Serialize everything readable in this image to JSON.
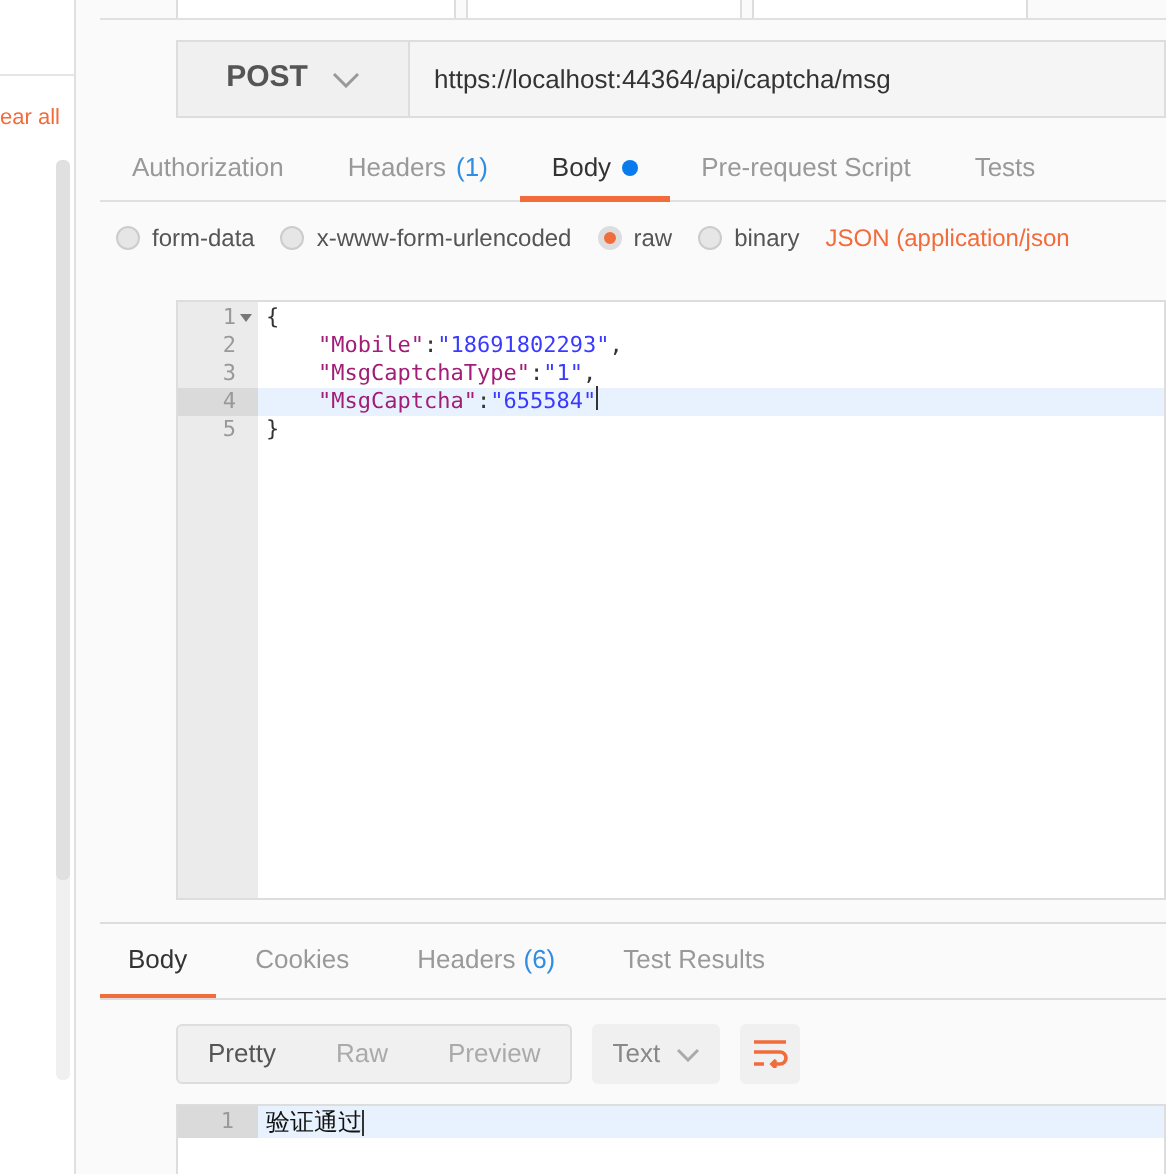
{
  "sidebar": {
    "clear_link": "ear all"
  },
  "request": {
    "method": "POST",
    "url": "https://localhost:44364/api/captcha/msg"
  },
  "request_tabs": [
    {
      "label": "Authorization",
      "dot": false,
      "selected": false
    },
    {
      "label": "Headers",
      "count": "(1)",
      "dot": false,
      "selected": false
    },
    {
      "label": "Body",
      "dot": true,
      "selected": true
    },
    {
      "label": "Pre-request Script",
      "dot": false,
      "selected": false
    },
    {
      "label": "Tests",
      "dot": false,
      "selected": false
    }
  ],
  "body_types": [
    {
      "label": "form-data",
      "selected": false
    },
    {
      "label": "x-www-form-urlencoded",
      "selected": false
    },
    {
      "label": "raw",
      "selected": true
    },
    {
      "label": "binary",
      "selected": false
    }
  ],
  "content_type": "JSON (application/json",
  "editor_lines": [
    {
      "number": "1",
      "fold": true,
      "current": false,
      "tokens": [
        {
          "kind": "punct",
          "text": "{"
        }
      ]
    },
    {
      "number": "2",
      "fold": false,
      "current": false,
      "tokens": [
        {
          "kind": "key",
          "text": "\"Mobile\""
        },
        {
          "kind": "punct",
          "text": ":"
        },
        {
          "kind": "string",
          "text": "\"18691802293\""
        },
        {
          "kind": "punct",
          "text": ","
        }
      ]
    },
    {
      "number": "3",
      "fold": false,
      "current": false,
      "tokens": [
        {
          "kind": "key",
          "text": "\"MsgCaptchaType\""
        },
        {
          "kind": "punct",
          "text": ":"
        },
        {
          "kind": "string",
          "text": "\"1\""
        },
        {
          "kind": "punct",
          "text": ","
        }
      ]
    },
    {
      "number": "4",
      "fold": false,
      "current": true,
      "tokens": [
        {
          "kind": "key",
          "text": "\"MsgCaptcha\""
        },
        {
          "kind": "punct",
          "text": ":"
        },
        {
          "kind": "string",
          "text": "\"655584\""
        }
      ]
    },
    {
      "number": "5",
      "fold": false,
      "current": false,
      "tokens": [
        {
          "kind": "punct",
          "text": "}"
        }
      ]
    }
  ],
  "response_tabs": [
    {
      "label": "Body",
      "selected": true
    },
    {
      "label": "Cookies",
      "selected": false
    },
    {
      "label": "Headers",
      "count": "(6)",
      "selected": false
    },
    {
      "label": "Test Results",
      "selected": false
    }
  ],
  "view_modes": [
    {
      "label": "Pretty",
      "selected": true
    },
    {
      "label": "Raw",
      "selected": false
    },
    {
      "label": "Preview",
      "selected": false
    }
  ],
  "format": "Text",
  "response_lines": [
    {
      "number": "1",
      "text": "验证通过",
      "current": true
    }
  ]
}
